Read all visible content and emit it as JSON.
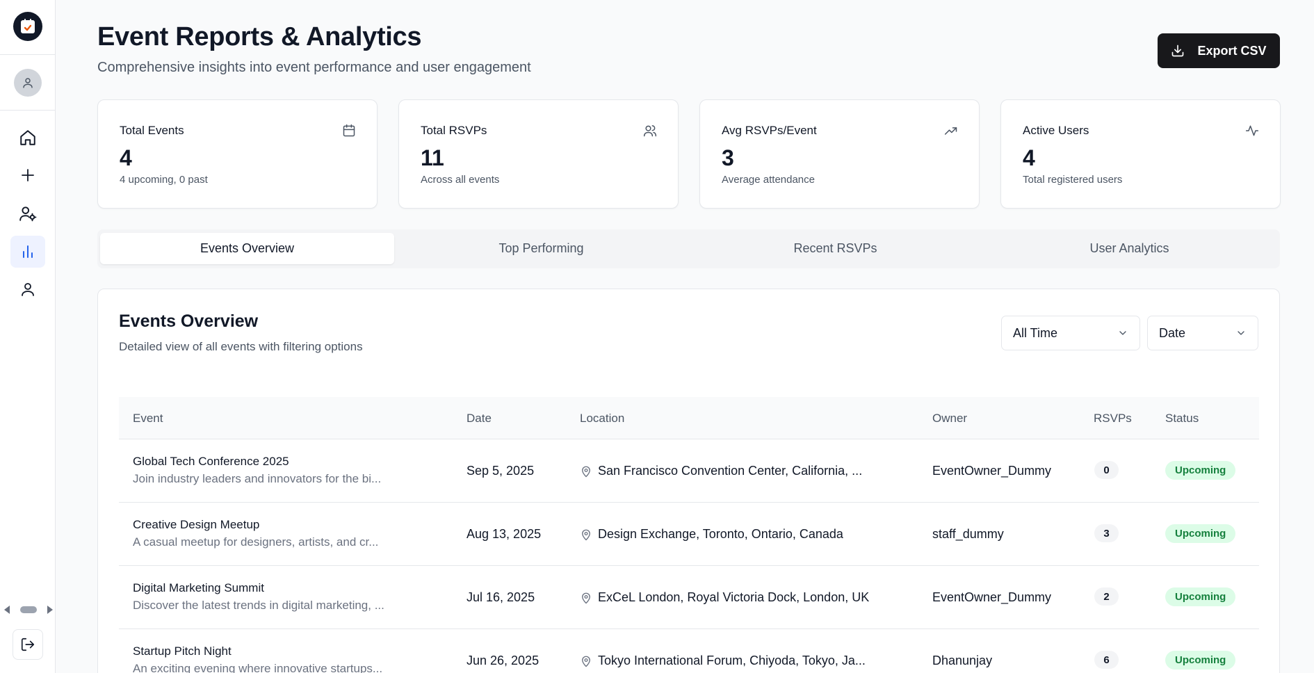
{
  "header": {
    "title": "Event Reports & Analytics",
    "subtitle": "Comprehensive insights into event performance and user engagement",
    "export_label": "Export CSV"
  },
  "stats": [
    {
      "label": "Total Events",
      "value": "4",
      "sub": "4 upcoming, 0 past",
      "icon": "calendar-icon"
    },
    {
      "label": "Total RSVPs",
      "value": "11",
      "sub": "Across all events",
      "icon": "users-icon"
    },
    {
      "label": "Avg RSVPs/Event",
      "value": "3",
      "sub": "Average attendance",
      "icon": "trending-up-icon"
    },
    {
      "label": "Active Users",
      "value": "4",
      "sub": "Total registered users",
      "icon": "activity-icon"
    }
  ],
  "tabs": [
    {
      "label": "Events Overview",
      "active": true
    },
    {
      "label": "Top Performing",
      "active": false
    },
    {
      "label": "Recent RSVPs",
      "active": false
    },
    {
      "label": "User Analytics",
      "active": false
    }
  ],
  "panel": {
    "title": "Events Overview",
    "description": "Detailed view of all events with filtering options",
    "filters": {
      "time": "All Time",
      "sort": "Date"
    }
  },
  "table": {
    "columns": [
      "Event",
      "Date",
      "Location",
      "Owner",
      "RSVPs",
      "Status"
    ],
    "rows": [
      {
        "name": "Global Tech Conference 2025",
        "desc": "Join industry leaders and innovators for the bi...",
        "date": "Sep 5, 2025",
        "location": "San Francisco Convention Center, California, ...",
        "owner": "EventOwner_Dummy",
        "rsvps": "0",
        "status": "Upcoming"
      },
      {
        "name": "Creative Design Meetup",
        "desc": "A casual meetup for designers, artists, and cr...",
        "date": "Aug 13, 2025",
        "location": "Design Exchange, Toronto, Ontario, Canada",
        "owner": "staff_dummy",
        "rsvps": "3",
        "status": "Upcoming"
      },
      {
        "name": "Digital Marketing Summit",
        "desc": "Discover the latest trends in digital marketing, ...",
        "date": "Jul 16, 2025",
        "location": "ExCeL London, Royal Victoria Dock, London, UK",
        "owner": "EventOwner_Dummy",
        "rsvps": "2",
        "status": "Upcoming"
      },
      {
        "name": "Startup Pitch Night",
        "desc": "An exciting evening where innovative startups...",
        "date": "Jun 26, 2025",
        "location": "Tokyo International Forum, Chiyoda, Tokyo, Ja...",
        "owner": "Dhanunjay",
        "rsvps": "6",
        "status": "Upcoming"
      }
    ]
  },
  "sidebar": {
    "nav": [
      "home-icon",
      "plus-icon",
      "user-settings-icon",
      "bar-chart-icon",
      "user-icon"
    ],
    "active": "bar-chart-icon"
  },
  "colors": {
    "accent": "#2563eb",
    "dark": "#18181b",
    "status_bg": "#dcfce7",
    "status_text": "#15803d"
  }
}
